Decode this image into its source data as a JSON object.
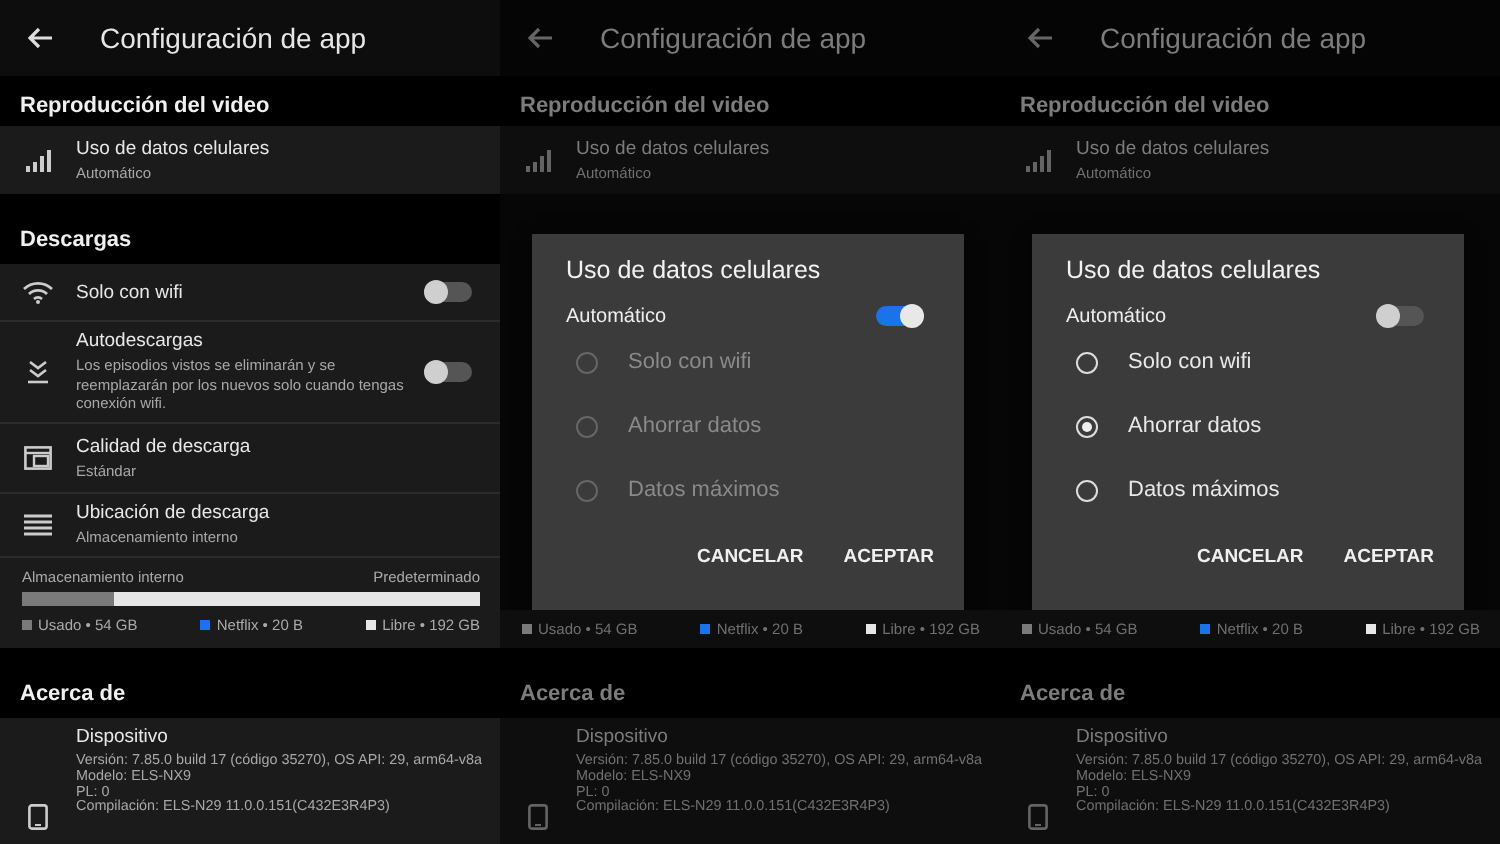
{
  "screens": [
    {
      "header": {
        "title": "Configuración de app"
      },
      "dimmed": false,
      "blocks": [
        {
          "kind": "heading",
          "text": "Reproducción del video"
        },
        {
          "kind": "cellular",
          "title": "Uso de datos celulares",
          "subtitle": "Automático"
        },
        {
          "kind": "heading",
          "text": "Descargas"
        },
        {
          "kind": "wifionly",
          "title": "Solo con wifi",
          "on": false
        },
        {
          "kind": "autodownload",
          "title": "Autodescargas",
          "subtitle": "Los episodios vistos se eliminarán y se reemplazarán por los nuevos solo cuando tengas conexión wifi.",
          "on": false
        },
        {
          "kind": "quality",
          "title": "Calidad de descarga",
          "subtitle": "Estándar"
        },
        {
          "kind": "location",
          "title": "Ubicación de descarga",
          "subtitle": "Almacenamiento interno"
        },
        {
          "kind": "storage",
          "label": "Almacenamiento interno",
          "note": "Predeterminado",
          "level": 0.2,
          "legend": [
            {
              "text": "Usado • 54 GB",
              "color": "#7a7a7a"
            },
            {
              "text": "Netflix • 20 B",
              "color": "#1a73e8"
            },
            {
              "text": "Libre • 192 GB",
              "color": "#e6e6e6"
            }
          ]
        },
        {
          "kind": "heading",
          "text": "Acerca de"
        },
        {
          "kind": "device",
          "title": "Dispositivo",
          "lines": [
            "Versión: 7.85.0 build 17 (código 35270), OS API: 29, arm64-v8a",
            "Modelo: ELS-NX9",
            "PL: 0",
            "Compilación: ELS-N29 11.0.0.151(C432E3R4P3)"
          ]
        }
      ]
    },
    {
      "header": {
        "title": "Configuración de app"
      },
      "dimmed": true,
      "blocks": [
        {
          "kind": "heading",
          "text": "Reproducción del video"
        },
        {
          "kind": "cellular",
          "title": "Uso de datos celulares",
          "subtitle": "Automático"
        },
        {
          "kind": "dialog",
          "title": "Uso de datos celulares",
          "automatic": {
            "label": "Automático",
            "on": true
          },
          "options": [
            {
              "label": "Solo con wifi",
              "selected": false,
              "disabled": true
            },
            {
              "label": "Ahorrar datos",
              "selected": false,
              "disabled": true
            },
            {
              "label": "Datos máximos",
              "selected": false,
              "disabled": true
            }
          ],
          "buttons": [
            "CANCELAR",
            "ACEPTAR"
          ]
        },
        {
          "kind": "legend",
          "legend": [
            {
              "text": "Usado • 54 GB",
              "color": "#7a7a7a"
            },
            {
              "text": "Netflix • 20 B",
              "color": "#1a73e8"
            },
            {
              "text": "Libre • 192 GB",
              "color": "#e6e6e6"
            }
          ]
        },
        {
          "kind": "heading",
          "text": "Acerca de"
        },
        {
          "kind": "device",
          "title": "Dispositivo",
          "lines": [
            "Versión: 7.85.0 build 17 (código 35270), OS API: 29, arm64-v8a",
            "Modelo: ELS-NX9",
            "PL: 0",
            "Compilación: ELS-N29 11.0.0.151(C432E3R4P3)"
          ]
        }
      ]
    },
    {
      "header": {
        "title": "Configuración de app"
      },
      "dimmed": true,
      "blocks": [
        {
          "kind": "heading",
          "text": "Reproducción del video"
        },
        {
          "kind": "cellular",
          "title": "Uso de datos celulares",
          "subtitle": "Automático"
        },
        {
          "kind": "dialog",
          "title": "Uso de datos celulares",
          "automatic": {
            "label": "Automático",
            "on": false
          },
          "options": [
            {
              "label": "Solo con wifi",
              "selected": false,
              "disabled": false
            },
            {
              "label": "Ahorrar datos",
              "selected": true,
              "disabled": false
            },
            {
              "label": "Datos máximos",
              "selected": false,
              "disabled": false
            }
          ],
          "buttons": [
            "CANCELAR",
            "ACEPTAR"
          ]
        },
        {
          "kind": "legend",
          "legend": [
            {
              "text": "Usado • 54 GB",
              "color": "#7a7a7a"
            },
            {
              "text": "Netflix • 20 B",
              "color": "#1a73e8"
            },
            {
              "text": "Libre • 192 GB",
              "color": "#e6e6e6"
            }
          ]
        },
        {
          "kind": "heading",
          "text": "Acerca de"
        },
        {
          "kind": "device",
          "title": "Dispositivo",
          "lines": [
            "Versión: 7.85.0 build 17 (código 35270), OS API: 29, arm64-v8a",
            "Modelo: ELS-NX9",
            "PL: 0",
            "Compilación: ELS-N29 11.0.0.151(C432E3R4P3)"
          ]
        }
      ]
    }
  ]
}
